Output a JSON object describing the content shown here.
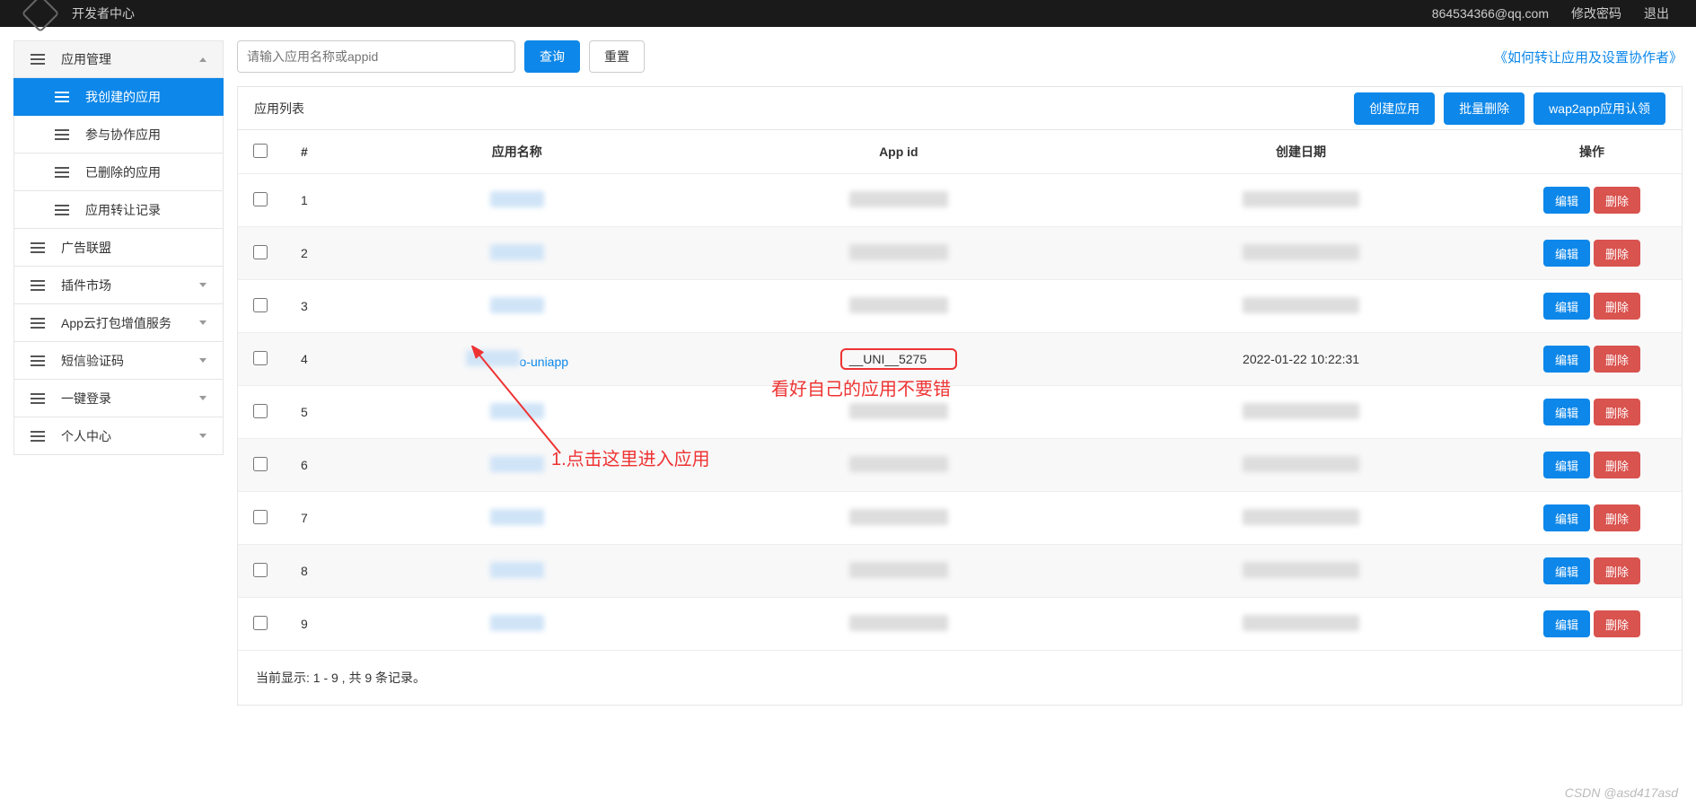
{
  "topbar": {
    "title": "开发者中心",
    "email": "864534366@qq.com",
    "change_pwd": "修改密码",
    "logout": "退出"
  },
  "sidebar": {
    "app_manage": "应用管理",
    "items": [
      {
        "label": "我创建的应用"
      },
      {
        "label": "参与协作应用"
      },
      {
        "label": "已删除的应用"
      },
      {
        "label": "应用转让记录"
      }
    ],
    "ad": "广告联盟",
    "plugin": "插件市场",
    "cloud": "App云打包增值服务",
    "sms": "短信验证码",
    "login": "一键登录",
    "personal": "个人中心"
  },
  "toolbar": {
    "search_placeholder": "请输入应用名称或appid",
    "query": "查询",
    "reset": "重置",
    "transfer_link": "《如何转让应用及设置协作者》"
  },
  "panel": {
    "title": "应用列表",
    "create": "创建应用",
    "batch_delete": "批量删除",
    "wap2app": "wap2app应用认领"
  },
  "table": {
    "headers": {
      "idx": "#",
      "name": "应用名称",
      "appid": "App id",
      "date": "创建日期",
      "action": "操作"
    },
    "edit": "编辑",
    "delete": "删除",
    "rows": [
      {
        "idx": "1"
      },
      {
        "idx": "2"
      },
      {
        "idx": "3"
      },
      {
        "idx": "4",
        "name": "o-uniapp",
        "appid": "__UNI__5275",
        "date": "2022-01-22 10:22:31",
        "highlight": true
      },
      {
        "idx": "5"
      },
      {
        "idx": "6"
      },
      {
        "idx": "7"
      },
      {
        "idx": "8"
      },
      {
        "idx": "9"
      }
    ],
    "footer": "当前显示: 1 - 9 , 共 9 条记录。"
  },
  "annotations": {
    "a1": "看好自己的应用不要错",
    "a2": "1.点击这里进入应用"
  },
  "watermark": "CSDN @asd417asd"
}
